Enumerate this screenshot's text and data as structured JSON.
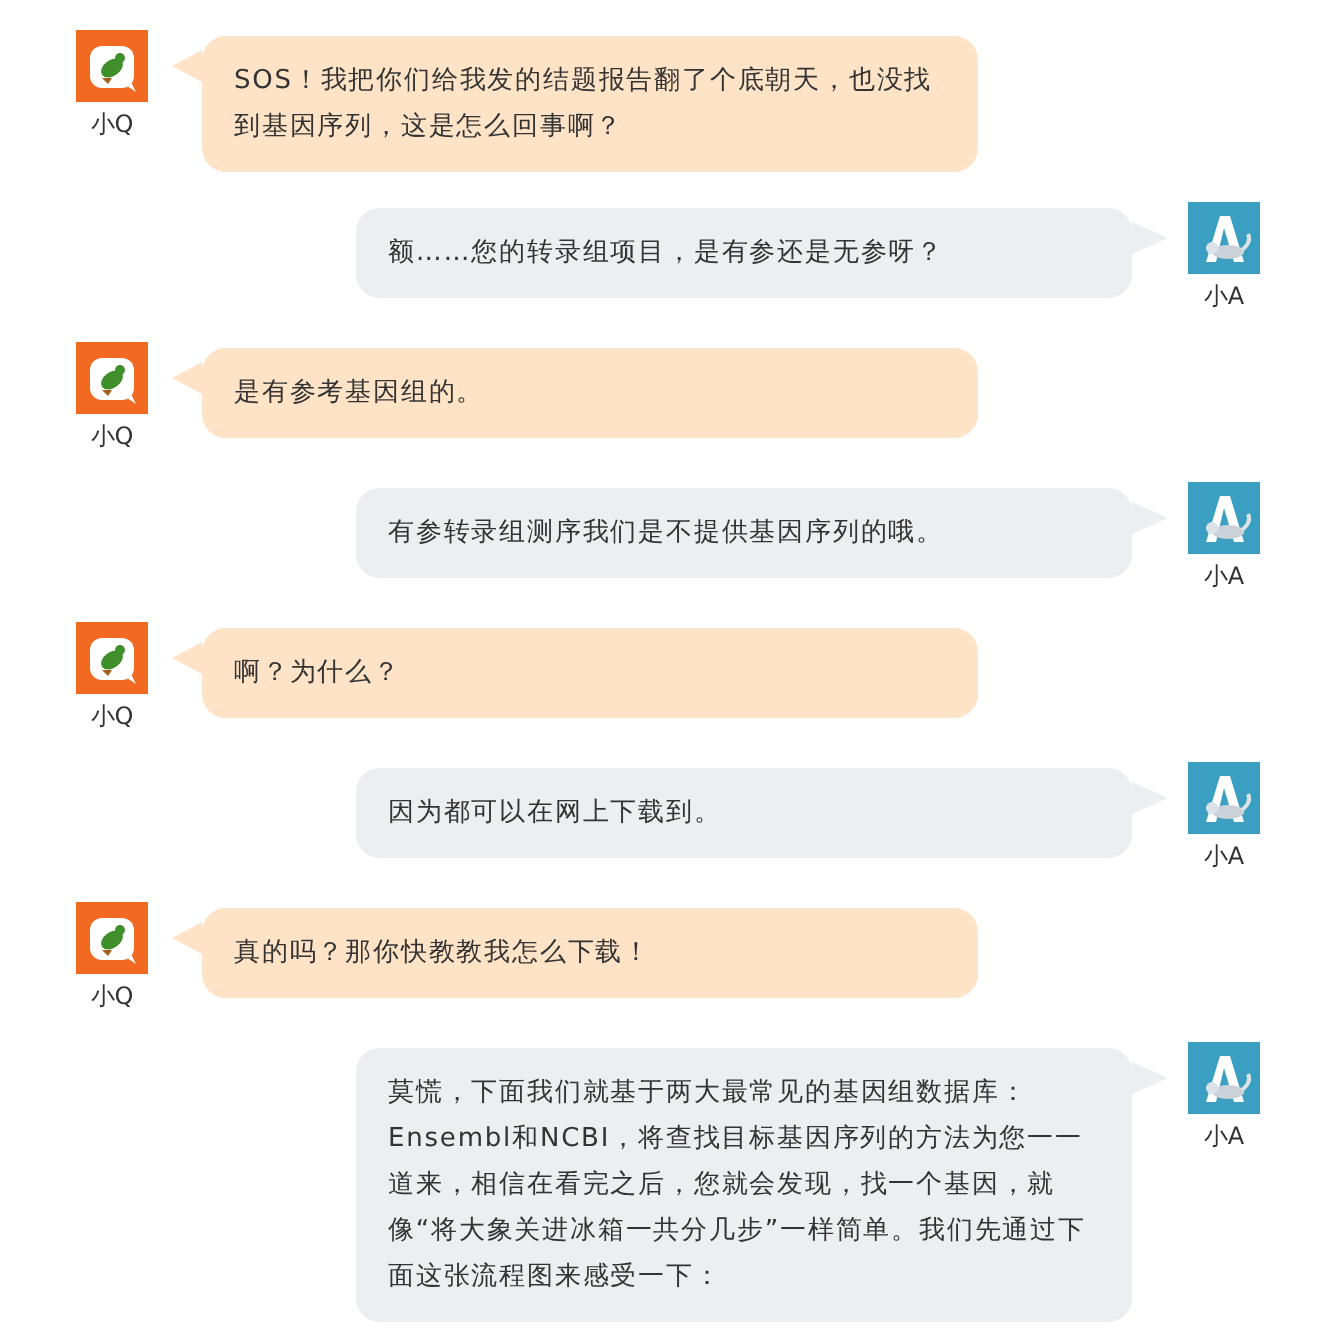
{
  "messages": [
    {
      "kind": "incoming",
      "name": "小Q",
      "text": "SOS！我把你们给我发的结题报告翻了个底朝天，也没找到基因序列，这是怎么回事啊？"
    },
    {
      "kind": "outgoing",
      "name": "小A",
      "text": "额……您的转录组项目，是有参还是无参呀？"
    },
    {
      "kind": "incoming",
      "name": "小Q",
      "text": "是有参考基因组的。"
    },
    {
      "kind": "outgoing",
      "name": "小A",
      "text": "有参转录组测序我们是不提供基因序列的哦。"
    },
    {
      "kind": "incoming",
      "name": "小Q",
      "text": "啊？为什么？"
    },
    {
      "kind": "outgoing",
      "name": "小A",
      "text": "因为都可以在网上下载到。"
    },
    {
      "kind": "incoming",
      "name": "小Q",
      "text": "真的吗？那你快教教我怎么下载！"
    },
    {
      "kind": "outgoing",
      "name": "小A",
      "text": "莫慌，下面我们就基于两大最常见的基因组数据库：Ensembl和NCBI，将查找目标基因序列的方法为您一一道来，相信在看完之后，您就会发现，找一个基因，就像“将大象关进冰箱一共分几步”一样简单。我们先通过下面这张流程图来感受一下："
    }
  ]
}
